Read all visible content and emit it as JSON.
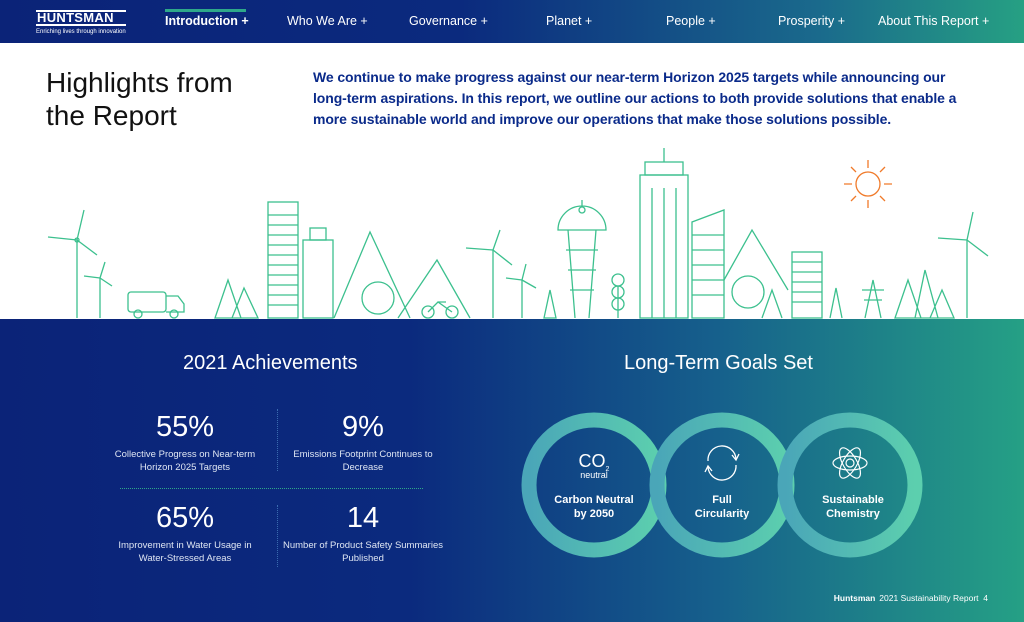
{
  "nav": {
    "logo": "HUNTSMAN",
    "tagline": "Enriching lives through innovation",
    "items": [
      "Introduction +",
      "Who We Are +",
      "Governance +",
      "Planet +",
      "People +",
      "Prosperity +",
      "About This Report +"
    ]
  },
  "header": {
    "title_line1": "Highlights from",
    "title_line2": "the Report",
    "intro": "We continue to make progress against our near-term Horizon 2025 targets while announcing our long-term aspirations. In this report, we outline our actions to both provide solutions that enable a more sustainable world and improve our operations that make those solutions possible."
  },
  "achievements": {
    "title": "2021 Achievements",
    "stats": [
      {
        "value": "55%",
        "label": "Collective Progress on Near-term Horizon 2025 Targets"
      },
      {
        "value": "9%",
        "label": "Emissions Footprint Continues to Decrease"
      },
      {
        "value": "65%",
        "label": "Improvement in Water Usage in Water-Stressed Areas"
      },
      {
        "value": "14",
        "label": "Number of Product Safety Summaries Published"
      }
    ]
  },
  "goals": {
    "title": "Long-Term Goals Set",
    "co2": "CO",
    "co2_sub": "2",
    "neutral": "neutral",
    "items": [
      {
        "line1": "Carbon Neutral",
        "line2": "by 2050",
        "icon": "co2-neutral-icon"
      },
      {
        "line1": "Full",
        "line2": "Circularity",
        "icon": "recycle-arrows-icon"
      },
      {
        "line1": "Sustainable",
        "line2": "Chemistry",
        "icon": "atom-leaf-icon"
      }
    ]
  },
  "footer": {
    "brand": "Huntsman",
    "report": "2021 Sustainability Report",
    "page": "4"
  },
  "colors": {
    "navy": "#0b2378",
    "teal": "#26a083",
    "line": "#3cc08e",
    "sun": "#f07a2a"
  }
}
